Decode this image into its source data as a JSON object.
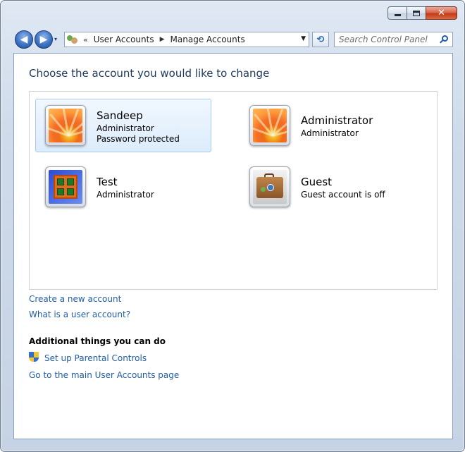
{
  "window": {
    "minimize_glyph": "minimize-icon",
    "maximize_glyph": "maximize-icon",
    "close_label": "✕"
  },
  "nav": {
    "back_glyph": "◀",
    "forward_glyph": "▶",
    "recent_glyph": "▾",
    "refresh_glyph": "⟲"
  },
  "address": {
    "chevron": "«",
    "segments": [
      "User Accounts",
      "Manage Accounts"
    ],
    "separator": "▶",
    "dropdown_glyph": "▼"
  },
  "search": {
    "placeholder": "Search Control Panel"
  },
  "page": {
    "title": "Choose the account you would like to change"
  },
  "accounts": [
    {
      "name": "Sandeep",
      "lines": [
        "Administrator",
        "Password protected"
      ],
      "picture": "flower",
      "selected": true
    },
    {
      "name": "Administrator",
      "lines": [
        "Administrator"
      ],
      "picture": "flower",
      "selected": false
    },
    {
      "name": "Test",
      "lines": [
        "Administrator"
      ],
      "picture": "chess",
      "selected": false
    },
    {
      "name": "Guest",
      "lines": [
        "Guest account is off"
      ],
      "picture": "suitcase",
      "selected": false
    }
  ],
  "links": {
    "create_account": "Create a new account",
    "what_is": "What is a user account?"
  },
  "additional": {
    "heading": "Additional things you can do",
    "parental_controls": "Set up Parental Controls",
    "main_page": "Go to the main User Accounts page"
  },
  "colors": {
    "title": "#1e395b",
    "link": "#1f5da6",
    "selection_border": "#a9cbef"
  }
}
